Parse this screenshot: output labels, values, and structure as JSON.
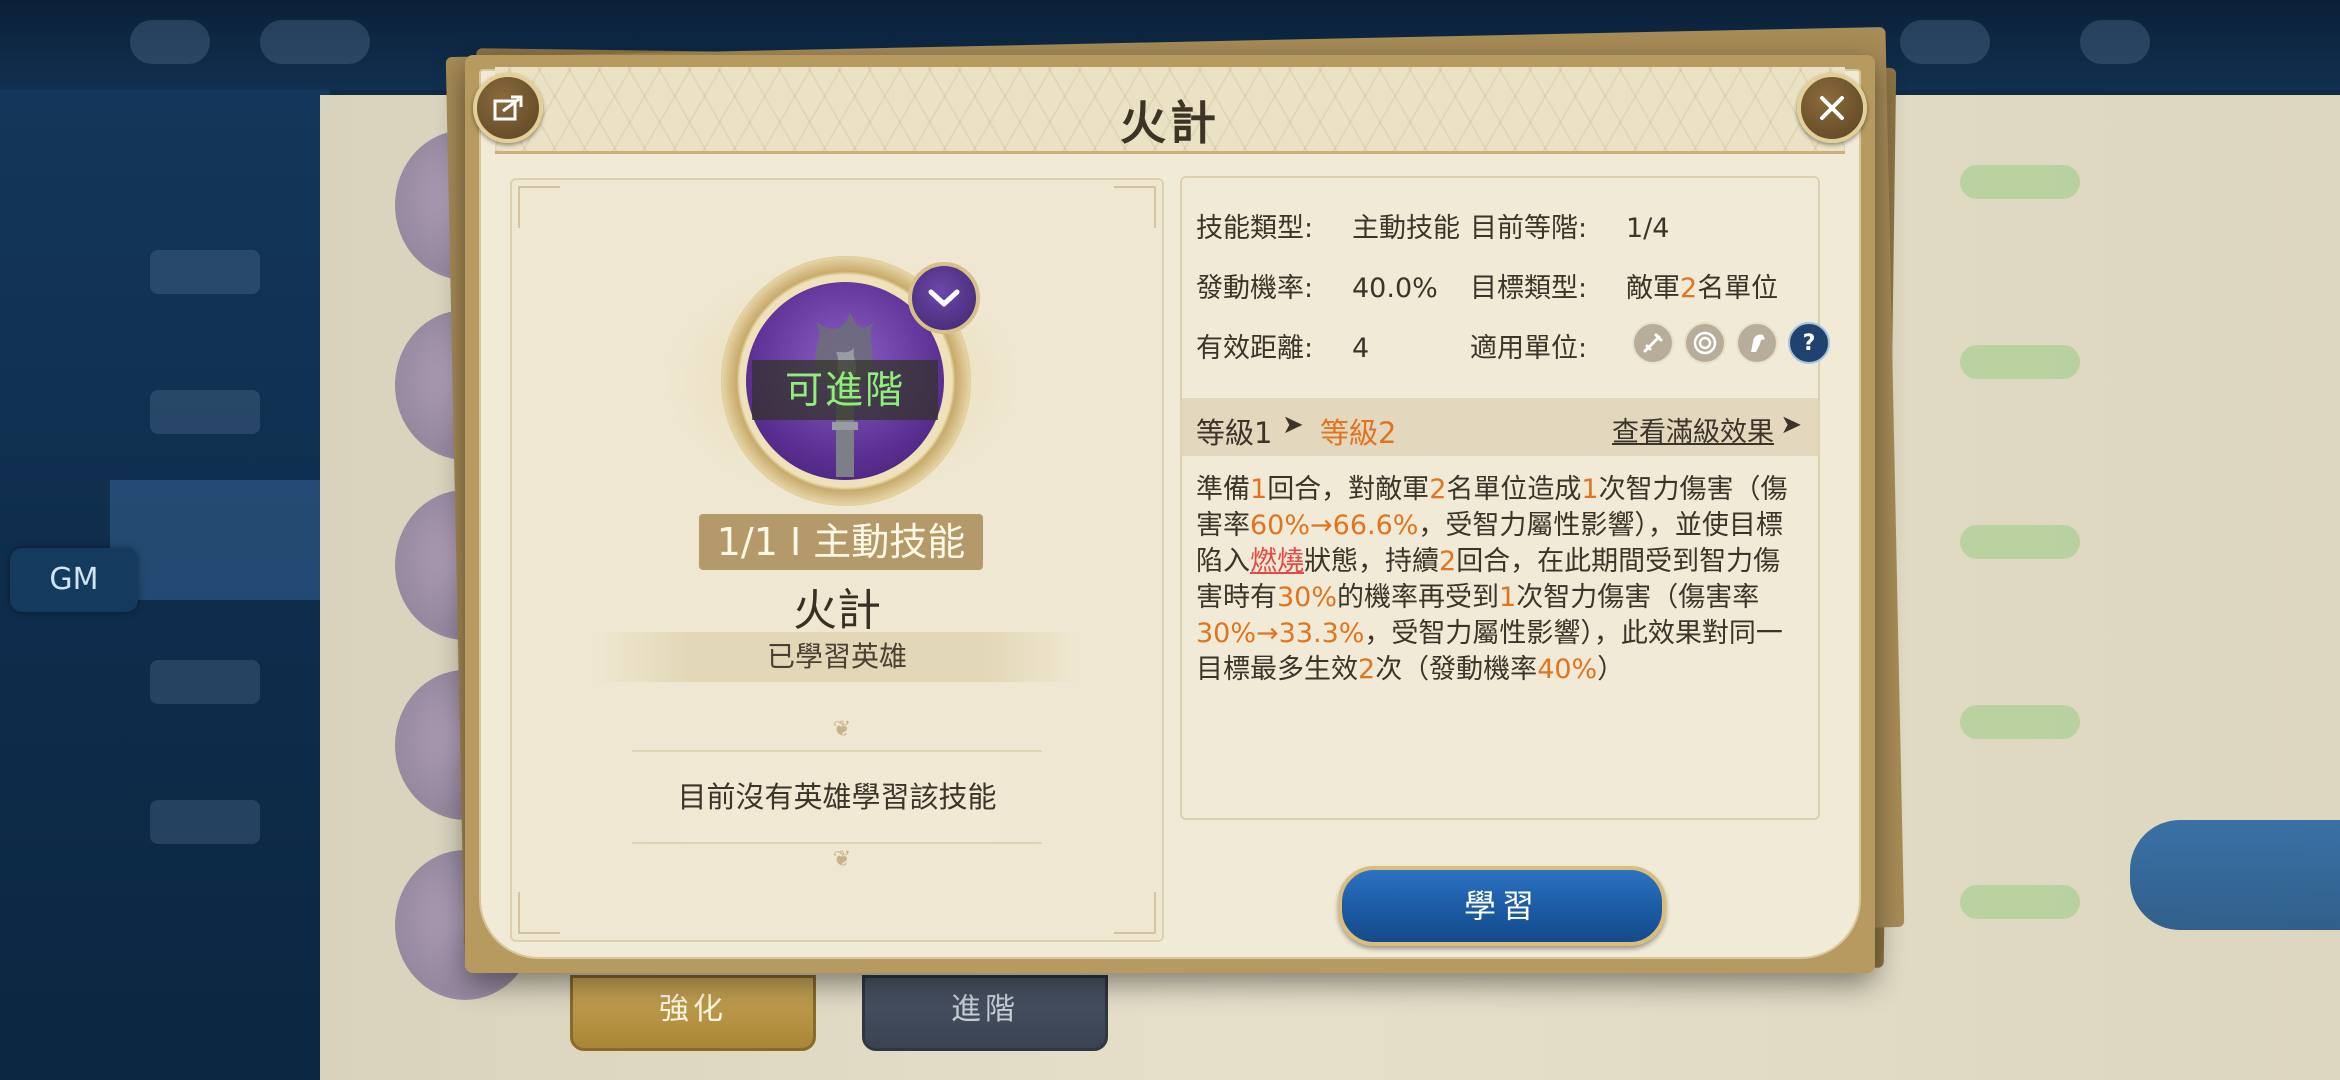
{
  "background": {
    "gm_button": "GM",
    "tabs": [
      {
        "label": "強化"
      },
      {
        "label": "進階"
      }
    ]
  },
  "dialog": {
    "title": "火計",
    "left": {
      "advance_status": "可進階",
      "rank_badge": "1/1 I 主動技能",
      "skill_name": "火計",
      "learned_label": "已學習英雄",
      "no_hero_text": "目前沒有英雄學習該技能"
    },
    "info": {
      "skill_type_label": "技能類型:",
      "skill_type_value": "主動技能",
      "current_rank_label": "目前等階:",
      "current_rank_value": "1/4",
      "trigger_rate_label": "發動機率:",
      "trigger_rate_value": "40.0%",
      "target_type_label": "目標類型:",
      "target_prefix": "敵軍",
      "target_count": "2",
      "target_suffix": "名單位",
      "range_label": "有效距離:",
      "range_value": "4",
      "units_label": "適用單位:",
      "unit_icons": [
        "sword-icon",
        "bow-target-icon",
        "cavalry-horse-icon",
        "help-question-icon"
      ]
    },
    "level": {
      "level1": "等級1",
      "level2": "等級2",
      "max_effect_link": "查看滿級效果"
    },
    "description": {
      "p1": "準備",
      "n1": "1",
      "p2": "回合，對敵軍",
      "n2": "2",
      "p3": "名單位造成",
      "n3": "1",
      "p4": "次智力傷害（傷害率",
      "n4": "60%→66.6%",
      "p5": "，受智力屬性影響），並使目標陷入",
      "burn": "燃燒",
      "p6": "狀態，持續",
      "n5": "2",
      "p7": "回合，在此期間受到智力傷害時有",
      "n6": "30%",
      "p8": "的機率再受到",
      "n7": "1",
      "p9": "次智力傷害（傷害率",
      "n8": "30%→33.3%",
      "p10": "，受智力屬性影響），此效果對同一目標最多生效",
      "n9": "2",
      "p11": "次（發動機率",
      "n10": "40%",
      "p12": "）"
    },
    "learn_button": "學習"
  },
  "colors": {
    "highlight": "#e0741f",
    "burn": "#e34a45",
    "advance_green": "#8ff079",
    "button_blue": "#1b5aa3"
  }
}
